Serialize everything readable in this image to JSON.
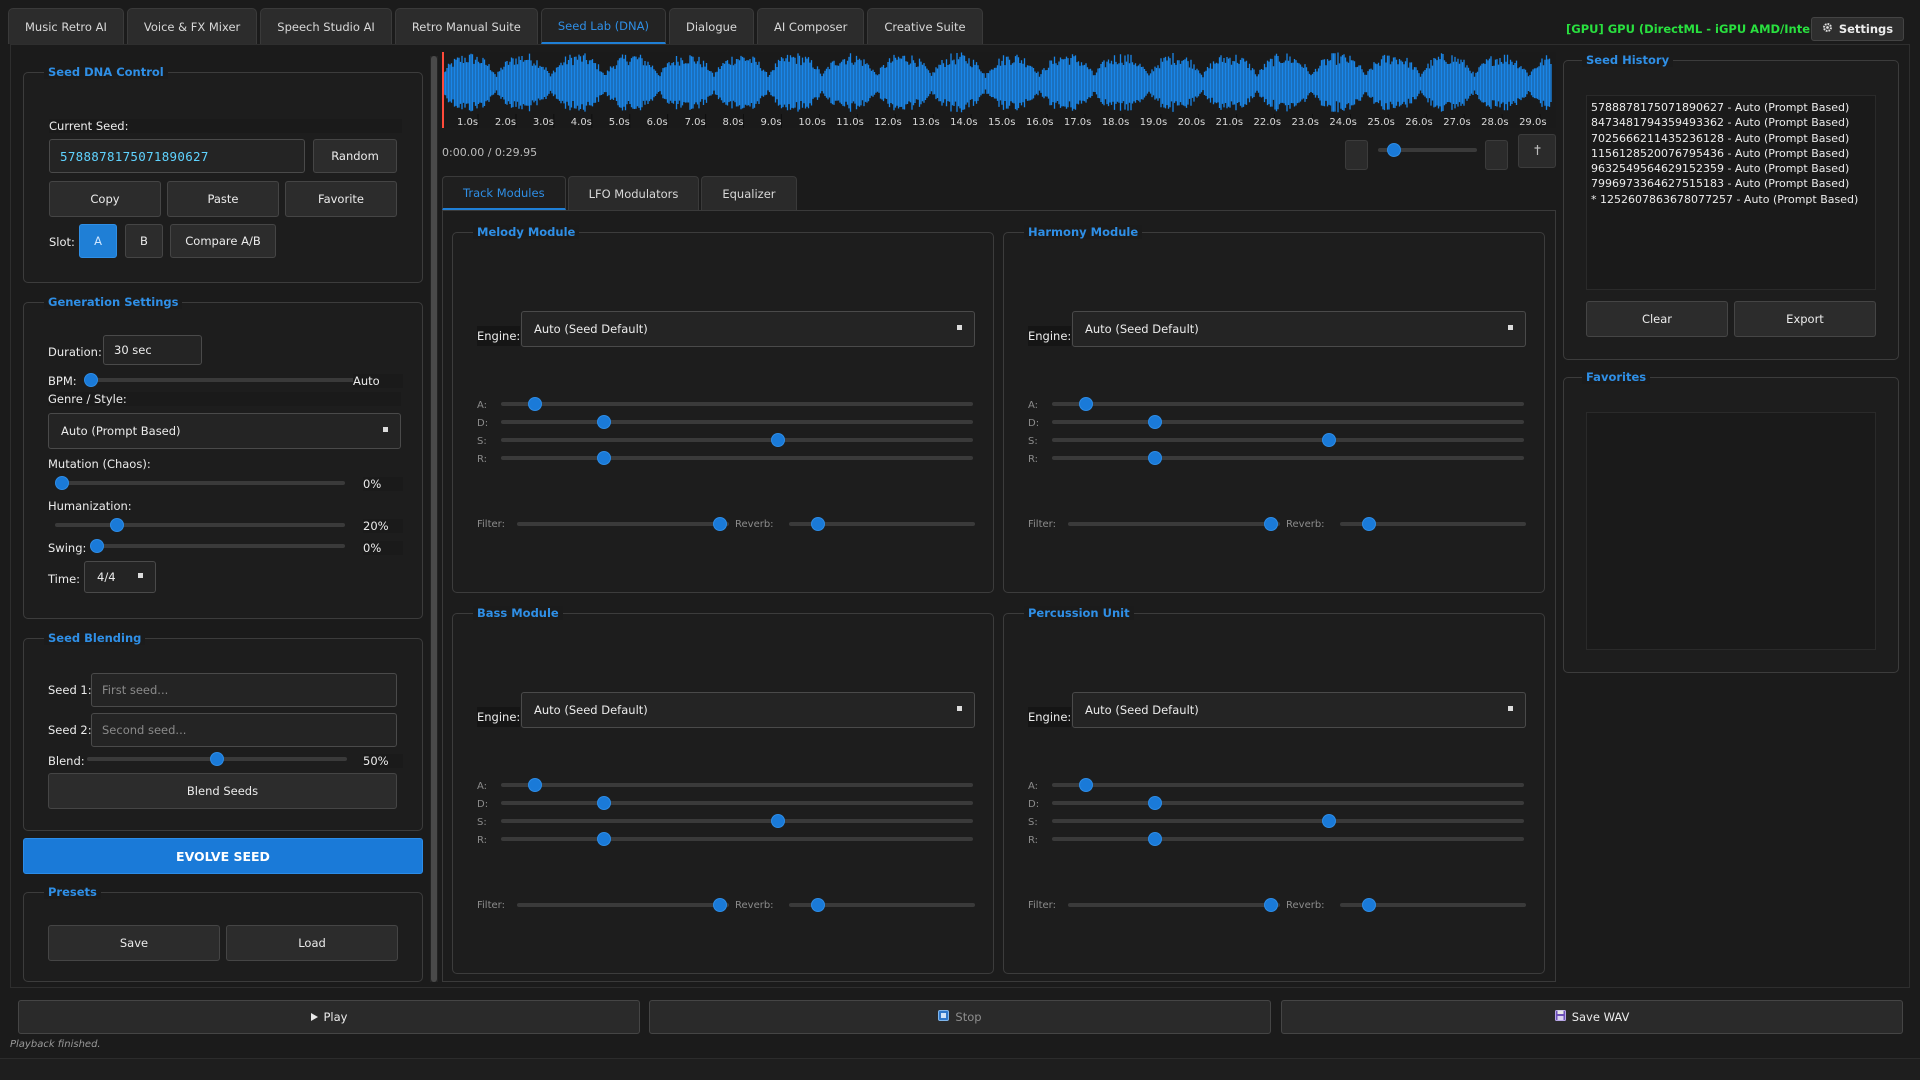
{
  "tabs": [
    {
      "label": "Music Retro AI"
    },
    {
      "label": "Voice & FX Mixer"
    },
    {
      "label": "Speech Studio AI"
    },
    {
      "label": "Retro Manual Suite"
    },
    {
      "label": "Seed Lab (DNA)"
    },
    {
      "label": "Dialogue"
    },
    {
      "label": "AI Composer"
    },
    {
      "label": "Creative Suite"
    }
  ],
  "active_tab": "Seed Lab (DNA)",
  "gpu_status": "[GPU] GPU (DirectML - iGPU AMD/Intel)",
  "settings_label": "Settings",
  "colors": {
    "accent": "#1f7fd6",
    "gpu_green": "#29e03f",
    "background": "#1b1b1b"
  },
  "seed_dna": {
    "title": "Seed DNA Control",
    "current_seed_label": "Current Seed:",
    "current_seed": "5788878175071890627",
    "random_label": "Random",
    "copy_label": "Copy",
    "paste_label": "Paste",
    "favorite_label": "Favorite",
    "slot_label": "Slot:",
    "slot_a": "A",
    "slot_b": "B",
    "compare_label": "Compare A/B",
    "selected_slot": "A"
  },
  "generation": {
    "title": "Generation Settings",
    "duration_label": "Duration:",
    "duration_value": "30 sec",
    "bpm_label": "BPM:",
    "bpm_value": "Auto",
    "bpm_fraction": 0,
    "genre_label": "Genre / Style:",
    "genre_value": "Auto (Prompt Based)",
    "mutation_label": "Mutation (Chaos):",
    "mutation_value": "0%",
    "mutation_fraction": 0,
    "humanization_label": "Humanization:",
    "humanization_value": "20%",
    "humanization_fraction": 0.2,
    "swing_label": "Swing:",
    "swing_value": "0%",
    "swing_fraction": 0,
    "time_label": "Time:",
    "time_value": "4/4"
  },
  "blending": {
    "title": "Seed Blending",
    "seed1_label": "Seed 1:",
    "seed1_placeholder": "First seed...",
    "seed2_label": "Seed 2:",
    "seed2_placeholder": "Second seed...",
    "blend_label": "Blend:",
    "blend_value": "50%",
    "blend_fraction": 0.5,
    "blend_button": "Blend Seeds"
  },
  "evolve_label": "EVOLVE SEED",
  "presets": {
    "title": "Presets",
    "save_label": "Save",
    "load_label": "Load"
  },
  "waveform": {
    "tick_labels": [
      "1.0s",
      "2.0s",
      "3.0s",
      "4.0s",
      "5.0s",
      "6.0s",
      "7.0s",
      "8.0s",
      "9.0s",
      "10.0s",
      "11.0s",
      "12.0s",
      "13.0s",
      "14.0s",
      "15.0s",
      "16.0s",
      "17.0s",
      "18.0s",
      "19.0s",
      "20.0s",
      "21.0s",
      "22.0s",
      "23.0s",
      "24.0s",
      "25.0s",
      "26.0s",
      "27.0s",
      "28.0s",
      "29.0s"
    ],
    "time_readout": "0:00.00 / 0:29.95",
    "volume_fraction": 0.1,
    "pin_icon": "pin-icon"
  },
  "module_tabs": [
    {
      "label": "Track Modules"
    },
    {
      "label": "LFO Modulators"
    },
    {
      "label": "Equalizer"
    }
  ],
  "modules": [
    {
      "title": "Melody Module",
      "engine_label": "Engine:",
      "engine_value": "Auto (Seed Default)",
      "a": 0.06,
      "d": 0.21,
      "s": 0.59,
      "r": 0.21,
      "filter_label": "Filter:",
      "filter": 0.99,
      "reverb_label": "Reverb:",
      "reverb": 0.13
    },
    {
      "title": "Harmony Module",
      "engine_label": "Engine:",
      "engine_value": "Auto (Seed Default)",
      "a": 0.06,
      "d": 0.21,
      "s": 0.59,
      "r": 0.21,
      "filter_label": "Filter:",
      "filter": 0.99,
      "reverb_label": "Reverb:",
      "reverb": 0.13
    },
    {
      "title": "Bass Module",
      "engine_label": "Engine:",
      "engine_value": "Auto (Seed Default)",
      "a": 0.06,
      "d": 0.21,
      "s": 0.59,
      "r": 0.21,
      "filter_label": "Filter:",
      "filter": 0.99,
      "reverb_label": "Reverb:",
      "reverb": 0.13
    },
    {
      "title": "Percussion Unit",
      "engine_label": "Engine:",
      "engine_value": "Auto (Seed Default)",
      "a": 0.06,
      "d": 0.21,
      "s": 0.59,
      "r": 0.21,
      "filter_label": "Filter:",
      "filter": 0.99,
      "reverb_label": "Reverb:",
      "reverb": 0.13
    }
  ],
  "adsr_labels": {
    "a": "A:",
    "d": "D:",
    "s": "S:",
    "r": "R:"
  },
  "history": {
    "title": "Seed History",
    "items": [
      "5788878175071890627 - Auto (Prompt Based)",
      "8473481794359493362 - Auto (Prompt Based)",
      "7025666211435236128 - Auto (Prompt Based)",
      "1156128520076795436 - Auto (Prompt Based)",
      "9632549564629152359 - Auto (Prompt Based)",
      "7996973364627515183 - Auto (Prompt Based)",
      "* 1252607863678077257 - Auto (Prompt Based)"
    ],
    "clear_label": "Clear",
    "export_label": "Export"
  },
  "favorites": {
    "title": "Favorites"
  },
  "playback": {
    "play_label": "Play",
    "stop_label": "Stop",
    "save_wav_label": "Save WAV"
  },
  "status": "Playback finished."
}
